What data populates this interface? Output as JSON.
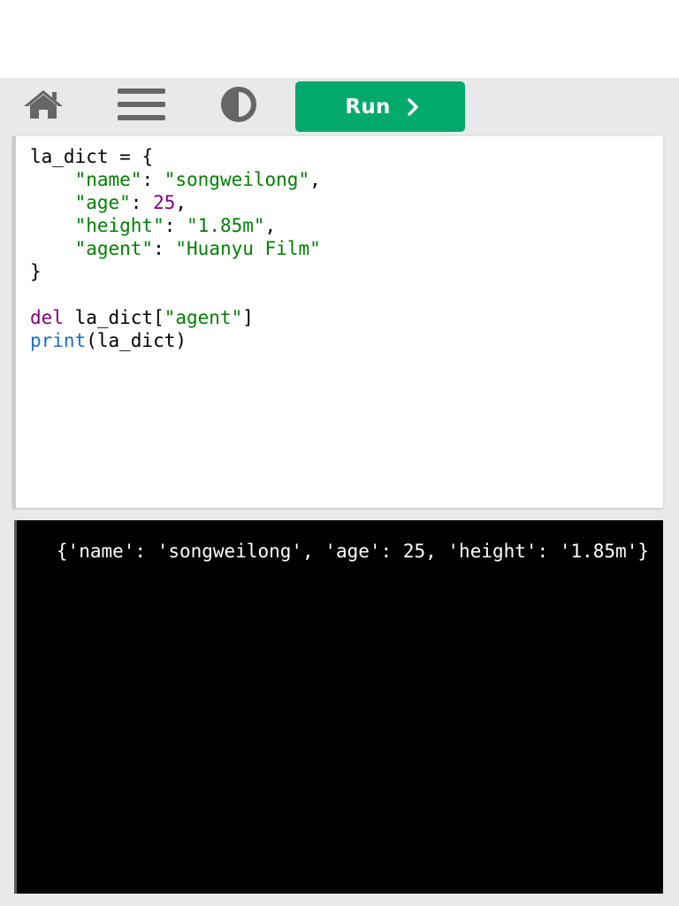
{
  "toolbar": {
    "home_icon": "home-icon",
    "menu_icon": "menu-icon",
    "theme_icon": "contrast-icon",
    "run_label": "Run",
    "run_color": "#04aa6d"
  },
  "editor": {
    "lines": [
      "la_dict = {",
      "\"name\": \"songweilong\",",
      "\"age\": 25,",
      "\"height\": \"1.85m\",",
      "\"agent\": \"Huanyu Film\"",
      "}",
      "del la_dict[\"agent\"]",
      "print(la_dict)"
    ],
    "tokens": {
      "var": "la_dict",
      "assign": " = {",
      "k_name": "\"name\"",
      "v_name": "\"songweilong\"",
      "k_age": "\"age\"",
      "v_age": "25",
      "k_height": "\"height\"",
      "v_height": "\"1.85m\"",
      "k_agent": "\"agent\"",
      "v_agent": "\"Huanyu Film\"",
      "close": "}",
      "kw_del": "del",
      "del_target": " la_dict[",
      "del_key": "\"agent\"",
      "del_close": "]",
      "fn_print": "print",
      "print_args": "(la_dict)"
    }
  },
  "output": {
    "text": "{'name': 'songweilong', 'age': 25, 'height': '1.85m'}"
  }
}
